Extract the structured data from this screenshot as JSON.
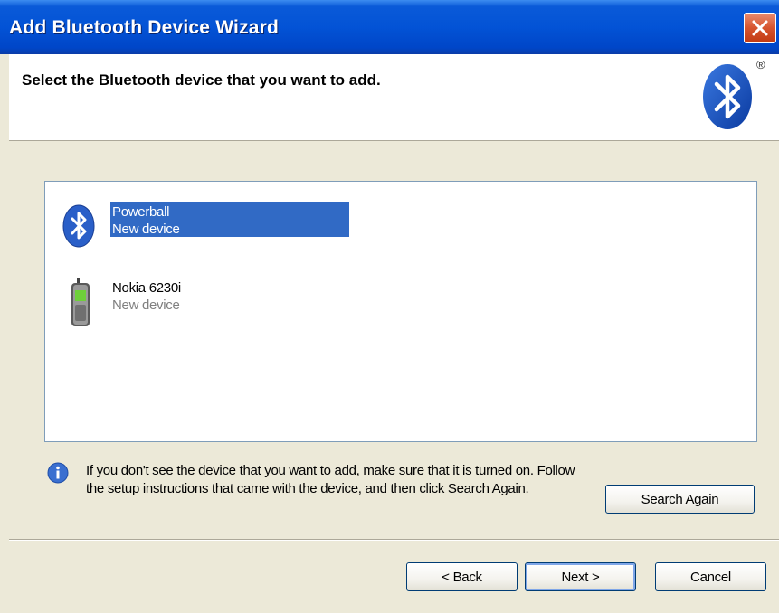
{
  "window": {
    "title": "Add Bluetooth Device Wizard",
    "close_icon": "close-icon",
    "colors": {
      "titlebar": "#0353d6",
      "selection": "#316ac5",
      "close": "#d6542e"
    }
  },
  "header": {
    "title": "Select the Bluetooth device that you want to add.",
    "logo_icon": "bluetooth-logo-icon",
    "registered_mark": "®"
  },
  "devices": [
    {
      "name": "Powerball",
      "status": "New device",
      "icon": "bluetooth-icon",
      "selected": true
    },
    {
      "name": "Nokia 6230i",
      "status": "New device",
      "icon": "mobile-phone-icon",
      "selected": false
    }
  ],
  "info": {
    "icon": "info-icon",
    "text": "If you don't see the device that you want to add, make sure that it is turned on. Follow the setup instructions that came with the device, and then click Search Again."
  },
  "buttons": {
    "search_again": "Search Again",
    "back": "< Back",
    "next": "Next >",
    "cancel": "Cancel"
  }
}
